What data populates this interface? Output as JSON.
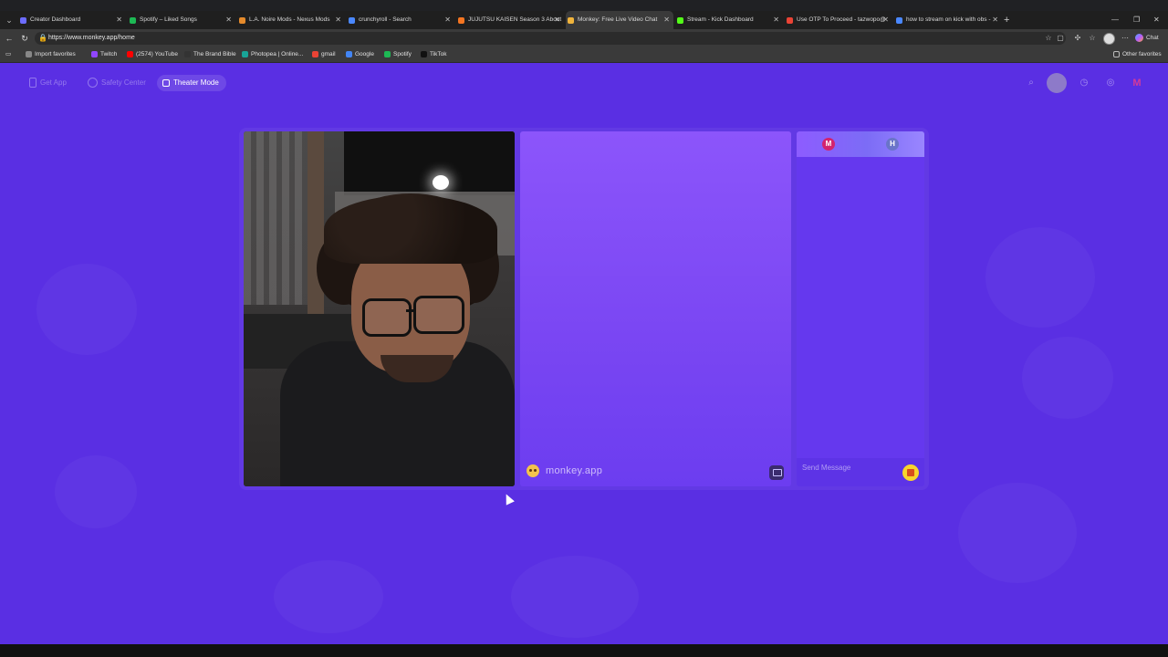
{
  "browser": {
    "tabs": [
      {
        "label": "Creator Dashboard",
        "color": "#6c6cff"
      },
      {
        "label": "Spotify – Liked Songs",
        "color": "#1db954"
      },
      {
        "label": "L.A. Noire Mods - Nexus Mods",
        "color": "#e58a2b"
      },
      {
        "label": "crunchyroll - Search",
        "color": "#4a88ff"
      },
      {
        "label": "JUJUTSU KAISEN Season 3 About",
        "color": "#f47521"
      },
      {
        "label": "Monkey: Free Live Video Chat",
        "color": "#f0b43c",
        "active": true
      },
      {
        "label": "Stream - Kick Dashboard",
        "color": "#53fc18"
      },
      {
        "label": "Use OTP To Proceed - tazwopo@",
        "color": "#ea4335"
      },
      {
        "label": "how to stream on kick with obs -",
        "color": "#4a88ff"
      }
    ],
    "url": "https://www.monkey.app/home",
    "copilot_label": "Chat",
    "bookmarks": [
      {
        "label": "Import favorites",
        "color": "#888888"
      },
      {
        "label": "Twitch",
        "color": "#9146ff"
      },
      {
        "label": "(2574) YouTube",
        "color": "#ff0000"
      },
      {
        "label": "The Brand Bible",
        "color": "#333333"
      },
      {
        "label": "Photopea | Online...",
        "color": "#18a497"
      },
      {
        "label": "gmail",
        "color": "#ea4335"
      },
      {
        "label": "Google",
        "color": "#4285f4"
      },
      {
        "label": "Spotify",
        "color": "#1db954"
      },
      {
        "label": "TikTok",
        "color": "#111111"
      }
    ],
    "other_favorites": "Other favorites"
  },
  "app": {
    "nav": {
      "get_app": "Get App",
      "safety_center": "Safety Center",
      "theater_mode": "Theater Mode"
    },
    "profile_initial": "M",
    "logo_text": "monkey.app",
    "chat": {
      "tab_m": "M",
      "tab_h": "H",
      "placeholder": "Send Message"
    },
    "colors": {
      "page_bg": "#5a2fe3",
      "chat_m": "#d3246f",
      "chat_h": "#6a74c9",
      "gift": "#f8d42c"
    }
  }
}
